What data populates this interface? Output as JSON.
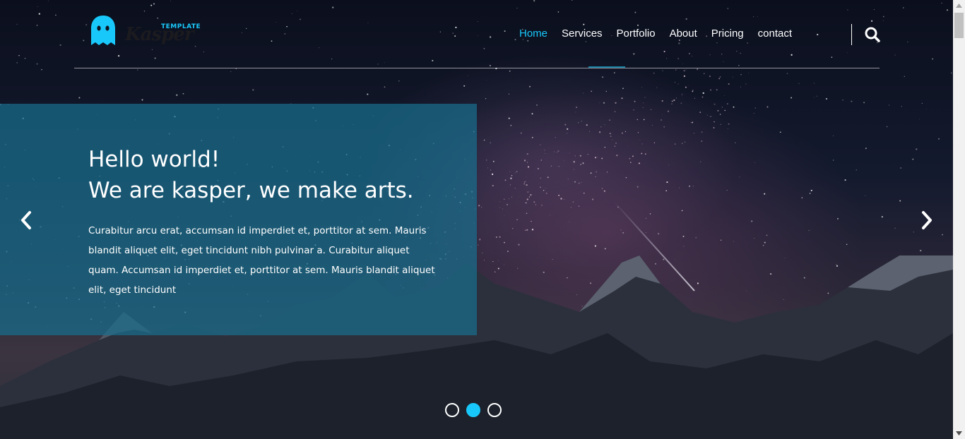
{
  "brand": {
    "name": "Kasper",
    "tag": "TEMPLATE"
  },
  "nav": {
    "items": [
      "Home",
      "Services",
      "Portfolio",
      "About",
      "Pricing",
      "contact"
    ],
    "active": "Home"
  },
  "hero": {
    "title_line1": "Hello world!",
    "title_line2": "We are kasper, we make arts.",
    "paragraph": "Curabitur arcu erat, accumsan id imperdiet et, porttitor at sem. Mauris blandit aliquet elit, eget tincidunt nibh pulvinar a. Curabitur aliquet quam. Accumsan id imperdiet et, porttitor at sem. Mauris blandit aliquet elit, eget tincidunt"
  },
  "slider": {
    "slide_count": 3,
    "active_index": 1
  },
  "colors": {
    "accent": "#19c8fa",
    "panel": "#196e8c",
    "text": "#ffffff"
  },
  "icons": [
    "ghost-logo-icon",
    "search-icon",
    "chevron-left-icon",
    "chevron-right-icon"
  ]
}
